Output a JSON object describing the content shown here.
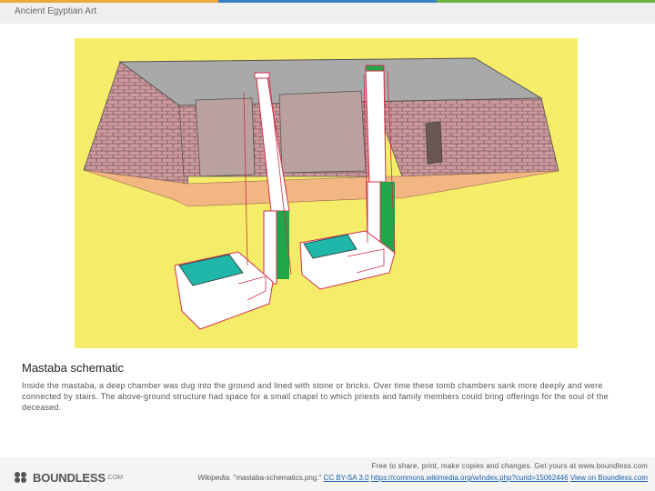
{
  "header": {
    "title": "Ancient Egyptian Art"
  },
  "topbar_colors": [
    "#e9a93a",
    "#3a7fc1",
    "#6fb544"
  ],
  "figure": {
    "icon": "mastaba-cross-section-illustration"
  },
  "caption": {
    "title": "Mastaba schematic",
    "body": "Inside the mastaba, a deep chamber was dug into the ground and lined with stone or bricks. Over time these tomb chambers sank more deeply and were connected by stairs. The above-ground structure had space for a small chapel to which priests and family members could bring offerings for the soul of the deceased."
  },
  "footer": {
    "logo_icon": "boundless-logo-icon",
    "logo_text": "BOUNDLESS",
    "logo_suffix": ".COM",
    "free_line": "Free to share, print, make copies and changes. Get yours at www.boundless.com",
    "credit_source": "Wikipedia.",
    "credit_title": " \"mastaba-schematics.png.\" ",
    "license_link": "CC BY-SA 3.0",
    "url_link": "https://commons.wikimedia.org/w/index.php?curid=15062446",
    "view_link": "View on Boundless.com"
  },
  "colors": {
    "background_yellow": "#f5ec6a",
    "brick": "#cc9a9e",
    "roof": "#a9a9a9",
    "chamber_wall": "#b8a19e",
    "ground_floor": "#f2b682",
    "shaft_green": "#22a64a",
    "lid_teal": "#1eb7a9",
    "outline_red": "#d0304a"
  }
}
